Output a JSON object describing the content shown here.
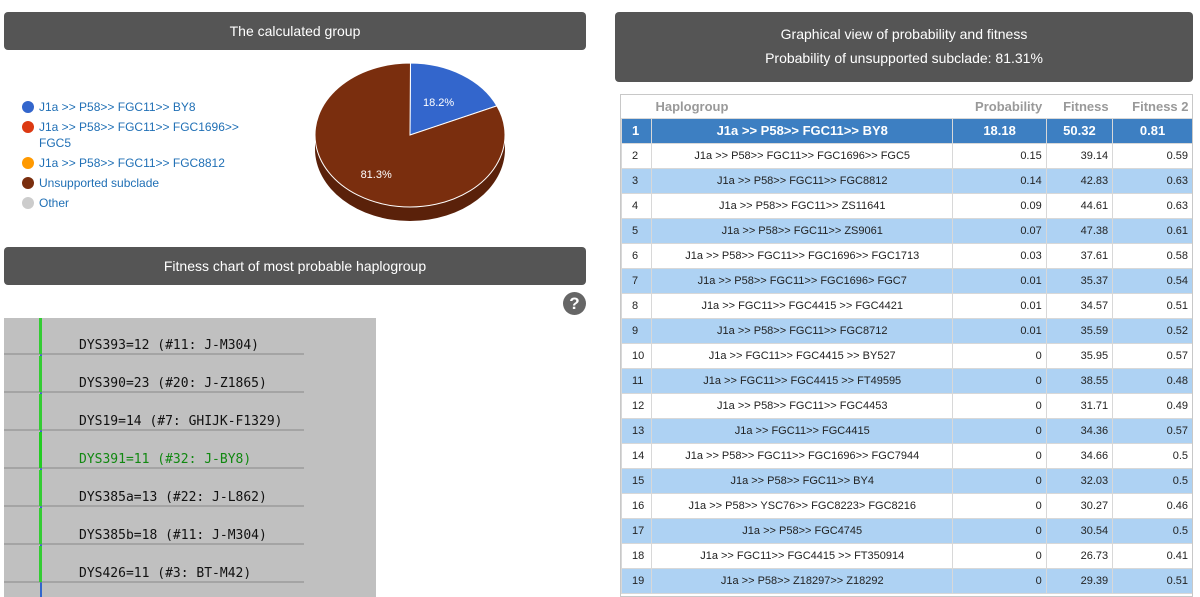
{
  "calc_panel": {
    "title": "The calculated group"
  },
  "legend": [
    {
      "label": "J1a >> P58>> FGC11>> BY8",
      "color": "#3366cc"
    },
    {
      "label": "J1a >> P58>> FGC11>> FGC1696>> FGC5",
      "color": "#dc3912"
    },
    {
      "label": "J1a >> P58>> FGC11>> FGC8812",
      "color": "#ff9900"
    },
    {
      "label": "Unsupported subclade",
      "color": "#7a2e0e"
    },
    {
      "label": "Other",
      "color": "#cccccc"
    }
  ],
  "pie": {
    "slices": [
      {
        "label": "18.2%",
        "value": 18.2,
        "color": "#3366cc"
      },
      {
        "label": "81.3%",
        "value": 81.3,
        "color": "#7a2e0e"
      }
    ]
  },
  "fitness_panel": {
    "title": "Fitness chart of most probable haplogroup"
  },
  "help": {
    "glyph": "?"
  },
  "markers": [
    {
      "text": "DYS393=12 (#11: J-M304)",
      "green": false
    },
    {
      "text": "DYS390=23 (#20: J-Z1865)",
      "green": false
    },
    {
      "text": "DYS19=14 (#7: GHIJK-F1329)",
      "green": false
    },
    {
      "text": "DYS391=11 (#32: J-BY8)",
      "green": true
    },
    {
      "text": "DYS385a=13 (#22: J-L862)",
      "green": false
    },
    {
      "text": "DYS385b=18 (#11: J-M304)",
      "green": false
    },
    {
      "text": "DYS426=11 (#3: BT-M42)",
      "green": false
    }
  ],
  "graph_panel": {
    "title": "Graphical view of probability and fitness",
    "subtitle": "Probability of unsupported subclade: 81.31%"
  },
  "table": {
    "headers": [
      "Haplogroup",
      "Probability",
      "Fitness",
      "Fitness 2"
    ],
    "rows": [
      [
        "1",
        "J1a >> P58>> FGC11>> BY8",
        "18.18",
        "50.32",
        "0.81"
      ],
      [
        "2",
        "J1a >> P58>> FGC11>> FGC1696>> FGC5",
        "0.15",
        "39.14",
        "0.59"
      ],
      [
        "3",
        "J1a >> P58>> FGC11>> FGC8812",
        "0.14",
        "42.83",
        "0.63"
      ],
      [
        "4",
        "J1a >> P58>> FGC11>> ZS11641",
        "0.09",
        "44.61",
        "0.63"
      ],
      [
        "5",
        "J1a >> P58>> FGC11>> ZS9061",
        "0.07",
        "47.38",
        "0.61"
      ],
      [
        "6",
        "J1a >> P58>> FGC11>> FGC1696>> FGC1713",
        "0.03",
        "37.61",
        "0.58"
      ],
      [
        "7",
        "J1a >> P58>> FGC11>> FGC1696> FGC7",
        "0.01",
        "35.37",
        "0.54"
      ],
      [
        "8",
        "J1a >> FGC11>> FGC4415 >> FGC4421",
        "0.01",
        "34.57",
        "0.51"
      ],
      [
        "9",
        "J1a >> P58>> FGC11>> FGC8712",
        "0.01",
        "35.59",
        "0.52"
      ],
      [
        "10",
        "J1a >> FGC11>> FGC4415 >> BY527",
        "0",
        "35.95",
        "0.57"
      ],
      [
        "11",
        "J1a >> FGC11>> FGC4415 >> FT49595",
        "0",
        "38.55",
        "0.48"
      ],
      [
        "12",
        "J1a >> P58>> FGC11>> FGC4453",
        "0",
        "31.71",
        "0.49"
      ],
      [
        "13",
        "J1a >> FGC11>> FGC4415",
        "0",
        "34.36",
        "0.57"
      ],
      [
        "14",
        "J1a >> P58>> FGC11>> FGC1696>> FGC7944",
        "0",
        "34.66",
        "0.5"
      ],
      [
        "15",
        "J1a >> P58>> FGC11>> BY4",
        "0",
        "32.03",
        "0.5"
      ],
      [
        "16",
        "J1a >> P58>> YSC76>> FGC8223> FGC8216",
        "0",
        "30.27",
        "0.46"
      ],
      [
        "17",
        "J1a >> P58>> FGC4745",
        "0",
        "30.54",
        "0.5"
      ],
      [
        "18",
        "J1a >> FGC11>> FGC4415 >> FT350914",
        "0",
        "26.73",
        "0.41"
      ],
      [
        "19",
        "J1a >> P58>> Z18297>> Z18292",
        "0",
        "29.39",
        "0.51"
      ]
    ]
  }
}
